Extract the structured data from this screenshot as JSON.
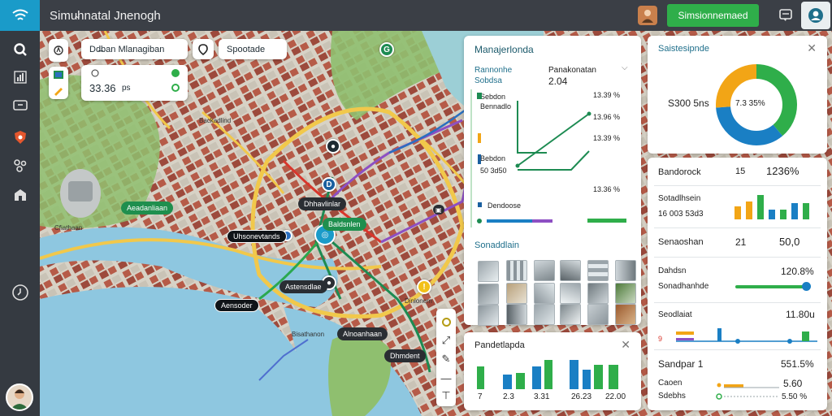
{
  "app": {
    "title": "Simu̴hnatal Jnenogh",
    "primary_button": "Simsionnemaed"
  },
  "overlay": {
    "search_label": "Dd̶ban Mlanagiban",
    "mode_label": "Spootade",
    "stat_value": "33.36",
    "stat_unit": "ps"
  },
  "map_labels": {
    "street_1": "Backadlind",
    "street_2": "Aeadanliaan",
    "station_1": "Uhsonevtands",
    "station_2": "Dhhavlinlar",
    "station_3": "Baldsnlen",
    "station_4": "Astensdlae",
    "station_5": "Aensoder",
    "station_6": "Bisathanon",
    "station_7": "Alnoanhaan",
    "station_8": "Dhmdent",
    "district": "Dinlonem",
    "district_2": "Cfiathaan"
  },
  "management_panel": {
    "title": "Manajerlonda",
    "field1_label": "Rannonhe",
    "field1_value": "Sobdsa",
    "field2_label": "Panakonatan",
    "field2_value": "2.04",
    "rows": [
      {
        "label": "Sebdon",
        "sub": "Bennadlo",
        "pct": "13.39 %"
      },
      {
        "label": "",
        "sub": "",
        "pct": "13.96 %"
      },
      {
        "label": "Bebdon",
        "sub": "50 3d50",
        "pct": "13.39 %"
      },
      {
        "label": "",
        "sub": "",
        "pct": "13.36 %"
      },
      {
        "label": "Dendoose",
        "sub": "",
        "pct": ""
      }
    ],
    "thumbs_title": "Sonaddlain"
  },
  "bottom_panel": {
    "title": "Pandetlapda",
    "ticks": [
      "7",
      "2.3",
      "3.31",
      "26.23",
      "22.00"
    ]
  },
  "status_panel": {
    "title": "Saistesipnde",
    "center_value": "7.3 35%",
    "side_value": "S300 5ns",
    "rows": [
      {
        "label": "Bandorock",
        "mid": "15",
        "value": "1236%"
      },
      {
        "label": "Sotadlhsein",
        "mid": "",
        "value": "16 003 53d3"
      },
      {
        "label": "Senaoshan",
        "mid": "21",
        "value": "50,0"
      },
      {
        "label": "Dahdsn",
        "mid": "",
        "value": "120.8%"
      },
      {
        "label": "Sonadhanhde",
        "mid": "",
        "value": ""
      },
      {
        "label": "Seodlaiat",
        "mid": "",
        "value": "11.80u"
      },
      {
        "label": "Sandpar 1",
        "mid": "",
        "value": "551.5%"
      },
      {
        "label": "Caoen",
        "mid": "",
        "value": "5.60"
      },
      {
        "label": "Sdebhs",
        "mid": "",
        "value": "5.50 %"
      }
    ]
  },
  "colors": {
    "accent_green": "#2fae4a",
    "accent_blue": "#1a7fc4",
    "accent_orange": "#f2a516",
    "sidebar": "#353a41",
    "water": "#8ec7e0"
  }
}
